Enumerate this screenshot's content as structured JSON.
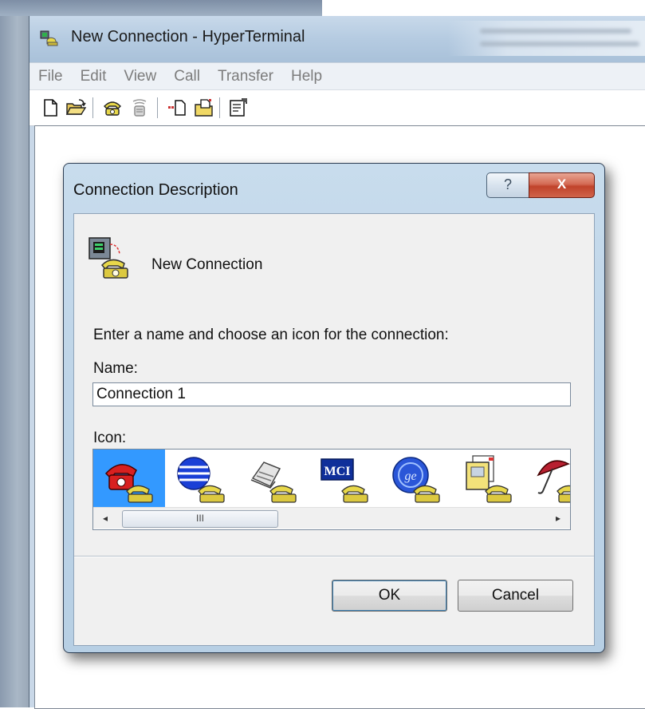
{
  "main_window": {
    "title": "New Connection - HyperTerminal",
    "menu": [
      "File",
      "Edit",
      "View",
      "Call",
      "Transfer",
      "Help"
    ],
    "toolbar_icons": [
      "new-document-icon",
      "open-folder-icon",
      "dial-phone-icon",
      "disconnect-phone-icon",
      "send-file-icon",
      "receive-file-icon",
      "properties-icon"
    ]
  },
  "dialog": {
    "title": "Connection Description",
    "help_button": "?",
    "close_button": "X",
    "header_name": "New Connection",
    "instruction": "Enter a name and choose an icon for the connection:",
    "name_label": "Name:",
    "name_value": "Connection 1",
    "icon_label": "Icon:",
    "icons": [
      "red-telephone-icon",
      "globe-icon",
      "fax-machine-icon",
      "mci-icon",
      "ge-globe-icon",
      "documents-icon",
      "umbrella-icon"
    ],
    "selected_icon_index": 0,
    "icon_mci_text": "MCI",
    "icon_ge_text": "ge",
    "scroll_left": "◂",
    "scroll_right": "▸",
    "scroll_grip": "III",
    "ok_label": "OK",
    "cancel_label": "Cancel"
  },
  "colors": {
    "selection": "#3399ff",
    "close_button": "#c0432b",
    "title_bar": "#b5cbe1"
  }
}
